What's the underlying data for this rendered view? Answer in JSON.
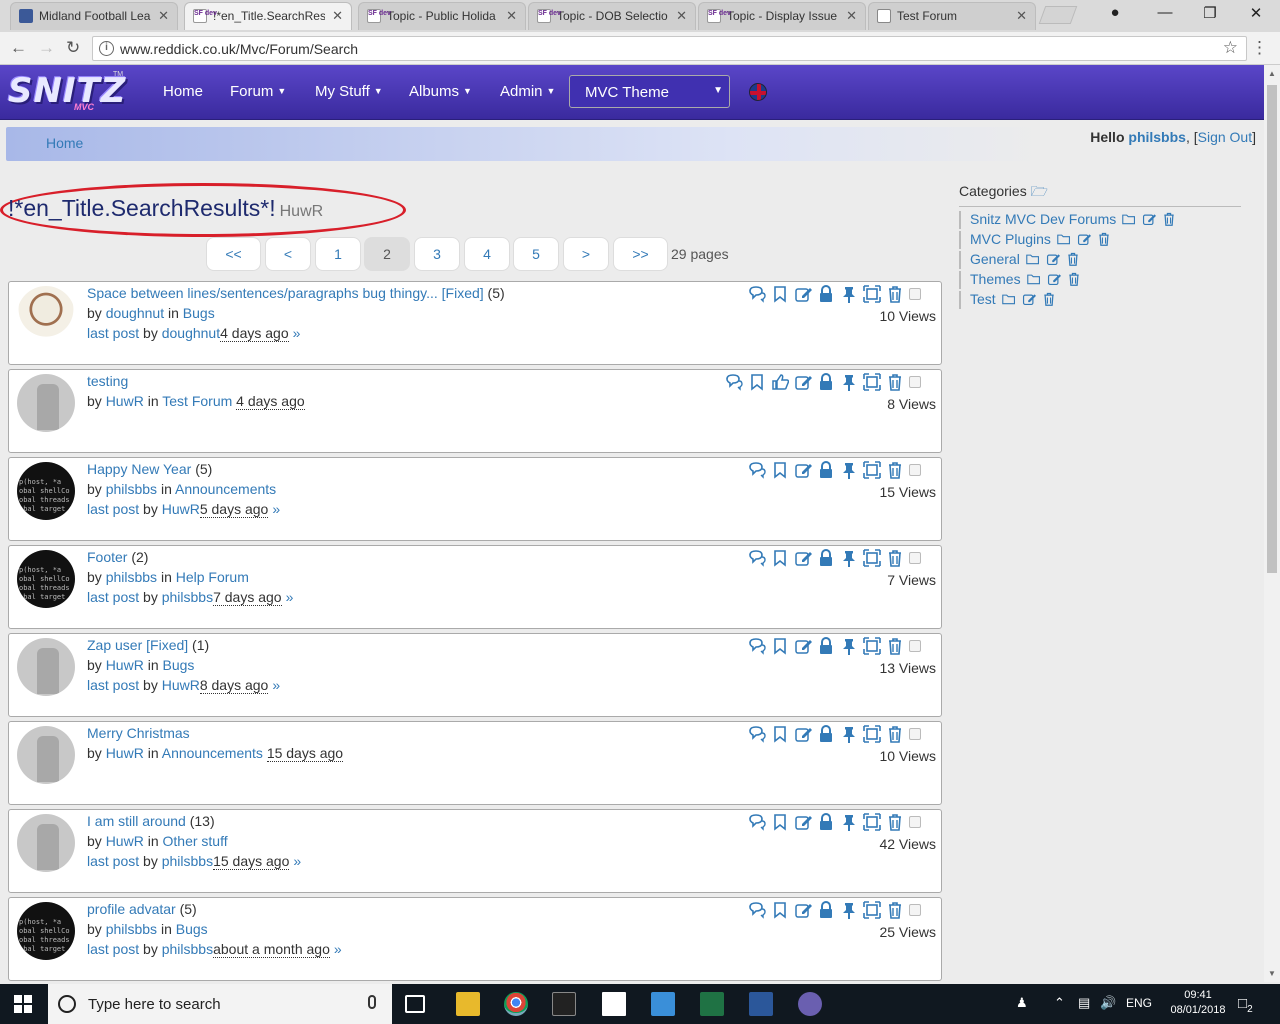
{
  "browser": {
    "tabs": [
      {
        "title": "Midland Football Lea",
        "favicon": "mfl"
      },
      {
        "title": "!*en_Title.SearchResu",
        "favicon": "sf",
        "active": true
      },
      {
        "title": "Topic - Public Holida",
        "favicon": "sf"
      },
      {
        "title": "Topic - DOB Selectio",
        "favicon": "sf"
      },
      {
        "title": "Topic - Display Issue",
        "favicon": "sf"
      },
      {
        "title": "Test Forum",
        "favicon": "doc"
      }
    ],
    "url": "www.reddick.co.uk/Mvc/Forum/Search"
  },
  "navbar": {
    "logo": "SNITZ",
    "logo_sub": "MVC",
    "logo_tm": "TM",
    "items": [
      "Home",
      "Forum",
      "My Stuff",
      "Albums",
      "Admin"
    ],
    "theme_select": "MVC Theme",
    "flag_icon": "uk-flag-icon"
  },
  "breadcrumb": {
    "home": "Home"
  },
  "greeting": {
    "hello": "Hello",
    "user": "philsbbs",
    "sign_out": "Sign Out"
  },
  "page": {
    "title": "!*en_Title.SearchResults*!",
    "subtitle": "HuwR"
  },
  "pagination": {
    "buttons": [
      "<<",
      "<",
      "1",
      "2",
      "3",
      "4",
      "5",
      ">",
      ">>"
    ],
    "active": "2",
    "total": "29 pages"
  },
  "topics": [
    {
      "title": "Space between lines/sentences/paragraphs bug thingy... [Fixed]",
      "replies": "(5)",
      "author": "doughnut",
      "forum": "Bugs",
      "last_by": "doughnut",
      "ago": "4 days ago",
      "views": "10 Views",
      "avatar": "dog",
      "like_icon": false
    },
    {
      "title": "testing",
      "replies": "",
      "author": "HuwR",
      "forum": "Test Forum",
      "last_by": "",
      "ago": "4 days ago",
      "views": "8 Views",
      "avatar": "grey",
      "like_icon": true
    },
    {
      "title": "Happy New Year",
      "replies": "(5)",
      "author": "philsbbs",
      "forum": "Announcements",
      "last_by": "HuwR",
      "ago": "5 days ago",
      "views": "15 Views",
      "avatar": "code",
      "like_icon": false
    },
    {
      "title": "Footer",
      "replies": "(2)",
      "author": "philsbbs",
      "forum": "Help Forum",
      "last_by": "philsbbs",
      "ago": "7 days ago",
      "views": "7 Views",
      "avatar": "code",
      "like_icon": false
    },
    {
      "title": "Zap user [Fixed]",
      "replies": "(1)",
      "author": "HuwR",
      "forum": "Bugs",
      "last_by": "HuwR",
      "ago": "8 days ago",
      "views": "13 Views",
      "avatar": "grey",
      "like_icon": false
    },
    {
      "title": "Merry Christmas",
      "replies": "",
      "author": "HuwR",
      "forum": "Announcements",
      "last_by": "",
      "ago": "15 days ago",
      "views": "10 Views",
      "avatar": "grey",
      "like_icon": false
    },
    {
      "title": "I am still around",
      "replies": "(13)",
      "author": "HuwR",
      "forum": "Other stuff",
      "last_by": "philsbbs",
      "ago": "15 days ago",
      "views": "42 Views",
      "avatar": "grey",
      "like_icon": false
    },
    {
      "title": "profile advatar",
      "replies": "(5)",
      "author": "philsbbs",
      "forum": "Bugs",
      "last_by": "philsbbs",
      "ago": "about a month ago",
      "views": "25 Views",
      "avatar": "code",
      "like_icon": false
    }
  ],
  "labels": {
    "by": "by",
    "in": "in",
    "last_post": "last post",
    "arrow": "»"
  },
  "avatar_code_lines": [
    "p(host, *a",
    "obal shellCo",
    "obal threads",
    "obal target"
  ],
  "sidebar": {
    "heading": "Categories",
    "categories": [
      "Snitz MVC Dev Forums",
      "MVC Plugins",
      "General",
      "Themes",
      "Test"
    ]
  },
  "taskbar": {
    "search_placeholder": "Type here to search",
    "lang": "ENG",
    "time": "09:41",
    "date": "08/01/2018",
    "notifications": "2"
  },
  "colors": {
    "accent": "#337ab7",
    "navbar": "#4a38b8",
    "highlight": "#d81f2a"
  }
}
